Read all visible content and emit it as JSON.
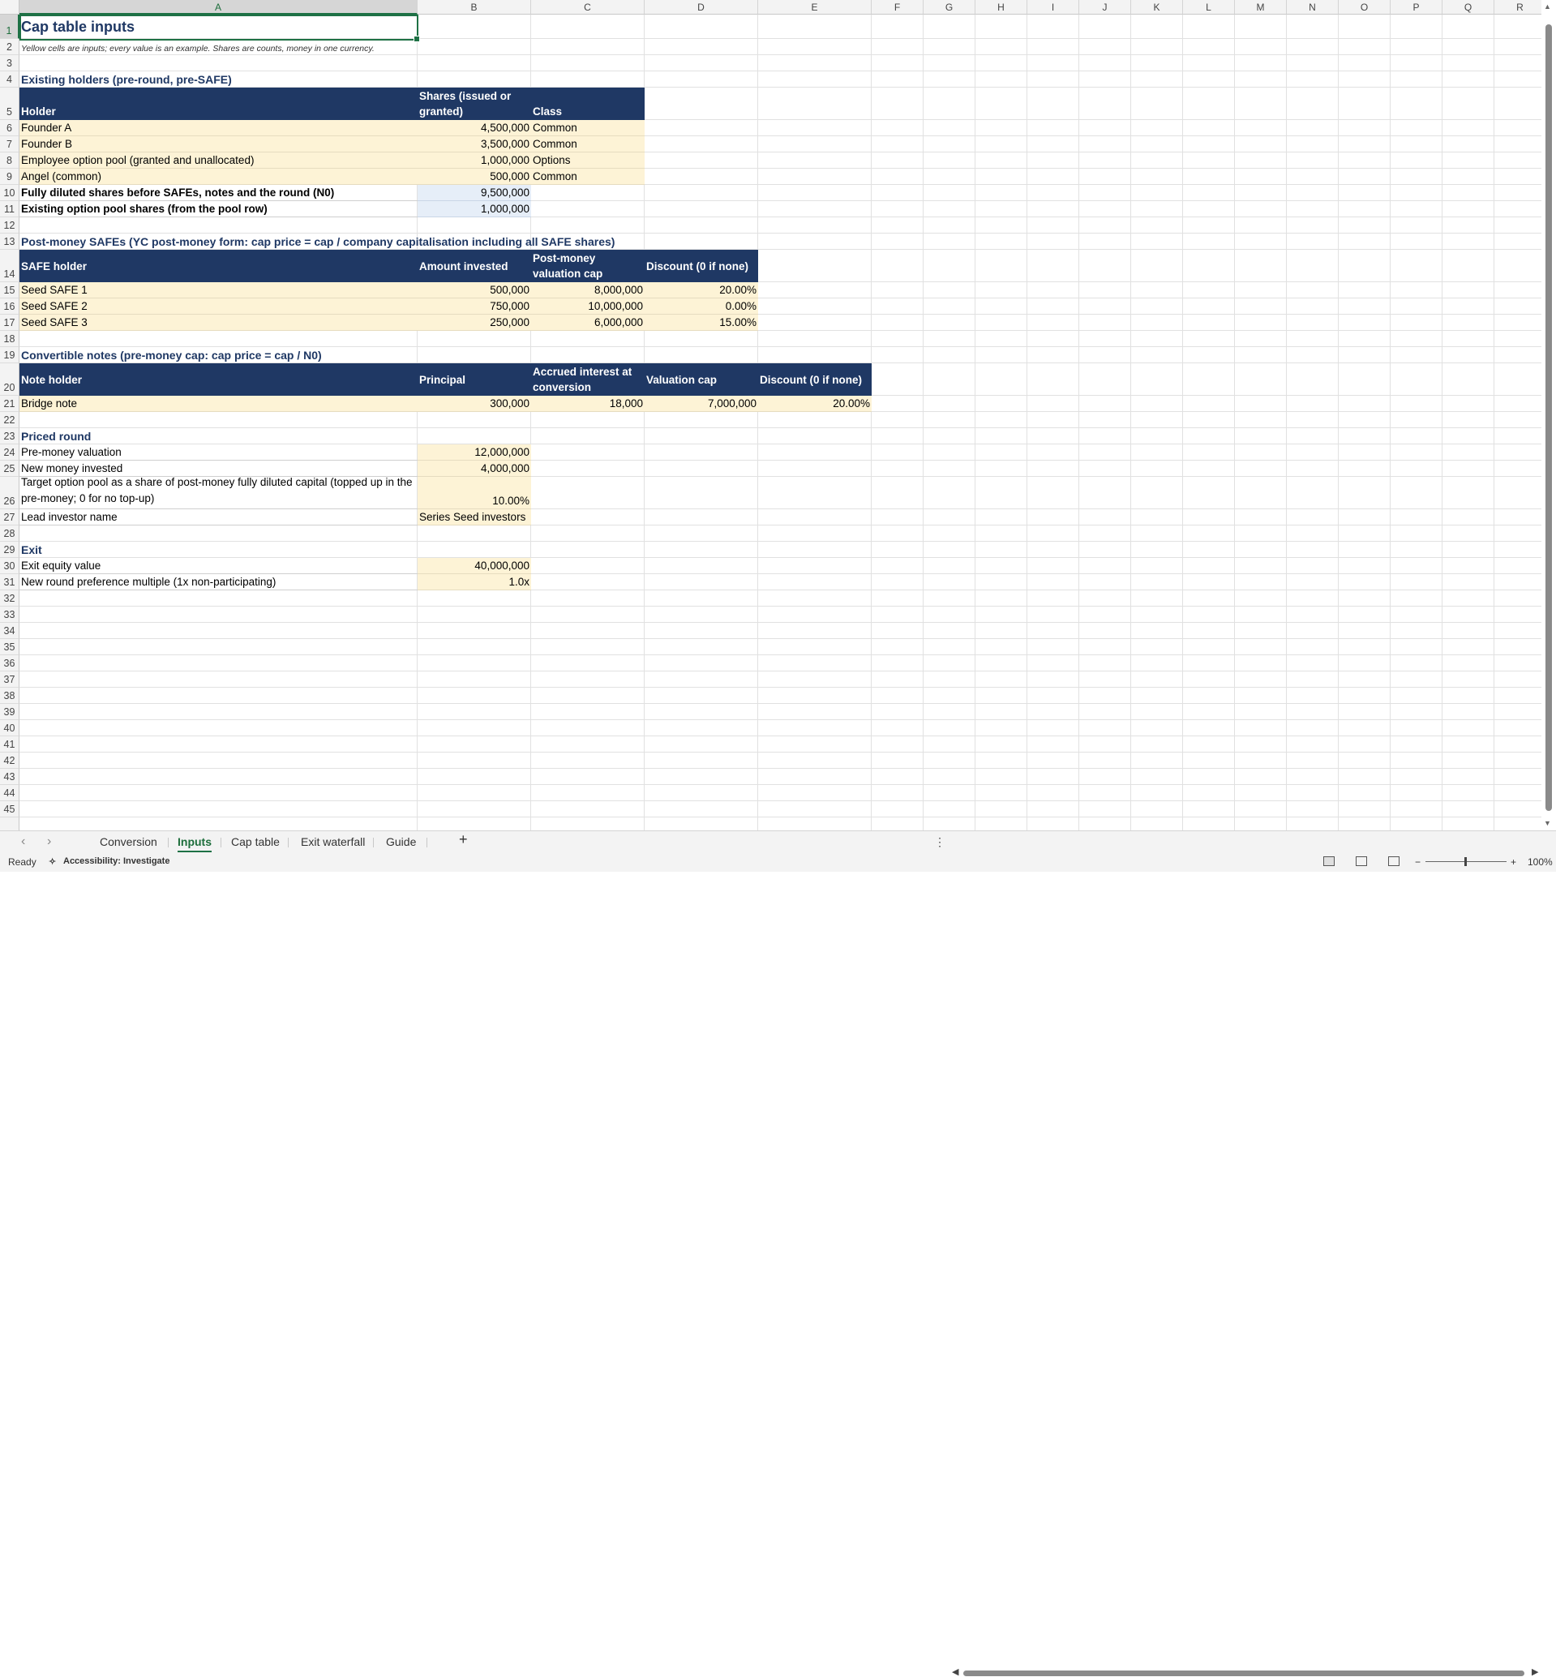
{
  "columns": [
    "A",
    "B",
    "C",
    "D",
    "E",
    "F",
    "G",
    "H",
    "I",
    "J",
    "K",
    "L",
    "M",
    "N",
    "O",
    "P",
    "Q",
    "R"
  ],
  "rows": [
    "1",
    "2",
    "3",
    "4",
    "5",
    "6",
    "7",
    "8",
    "9",
    "10",
    "11",
    "12",
    "13",
    "14",
    "15",
    "16",
    "17",
    "18",
    "19",
    "20",
    "21",
    "22",
    "23",
    "24",
    "25",
    "26",
    "27",
    "28",
    "29",
    "30",
    "31",
    "32",
    "33",
    "34",
    "35",
    "36",
    "37",
    "38",
    "39",
    "40",
    "41",
    "42",
    "43",
    "44",
    "45"
  ],
  "sheet": {
    "title": "Cap table inputs",
    "note": "Yellow cells are inputs; every value is an example. Shares are counts, money in one currency.",
    "holders": {
      "section": "Existing holders (pre-round, pre-SAFE)",
      "headers": [
        "Holder",
        "Shares (issued or granted)",
        "Class"
      ],
      "rows": [
        [
          "Founder A",
          "4,500,000",
          "Common"
        ],
        [
          "Founder B",
          "3,500,000",
          "Common"
        ],
        [
          "Employee option pool (granted and unallocated)",
          "1,000,000",
          "Options"
        ],
        [
          "Angel (common)",
          "500,000",
          "Common"
        ]
      ],
      "fd_label": "Fully diluted shares before SAFEs, notes and the round (N0)",
      "fd_value": "9,500,000",
      "pool_label": "Existing option pool shares (from the pool row)",
      "pool_value": "1,000,000"
    },
    "safes": {
      "section": "Post-money SAFEs (YC post-money form: cap price = cap / company capitalisation including all SAFE shares)",
      "headers": [
        "SAFE holder",
        "Amount invested",
        "Post-money valuation cap",
        "Discount (0 if none)"
      ],
      "rows": [
        [
          "Seed SAFE 1",
          "500,000",
          "8,000,000",
          "20.00%"
        ],
        [
          "Seed SAFE 2",
          "750,000",
          "10,000,000",
          "0.00%"
        ],
        [
          "Seed SAFE 3",
          "250,000",
          "6,000,000",
          "15.00%"
        ]
      ]
    },
    "notes": {
      "section": "Convertible notes (pre-money cap: cap price = cap / N0)",
      "headers": [
        "Note holder",
        "Principal",
        "Accrued interest at conversion",
        "Valuation cap",
        "Discount (0 if none)"
      ],
      "rows": [
        [
          "Bridge note",
          "300,000",
          "18,000",
          "7,000,000",
          "20.00%"
        ]
      ]
    },
    "priced": {
      "section": "Priced round",
      "rows": [
        [
          "Pre-money valuation",
          "12,000,000"
        ],
        [
          "New money invested",
          "4,000,000"
        ],
        [
          "Target option pool as a share of post-money fully diluted capital (topped up in the pre-money; 0 for no top-up)",
          "10.00%"
        ],
        [
          "Lead investor name",
          "Series Seed investors"
        ]
      ]
    },
    "exit": {
      "section": "Exit",
      "rows": [
        [
          "Exit equity value",
          "40,000,000"
        ],
        [
          "New round preference multiple (1x non-participating)",
          "1.0x"
        ]
      ]
    }
  },
  "tabs": [
    "Conversion",
    "Inputs",
    "Cap table",
    "Exit waterfall",
    "Guide"
  ],
  "active_tab": "Inputs",
  "add_sheet": "+",
  "status": {
    "ready": "Ready",
    "accessibility": "Accessibility: Investigate",
    "zoom": "100%"
  }
}
